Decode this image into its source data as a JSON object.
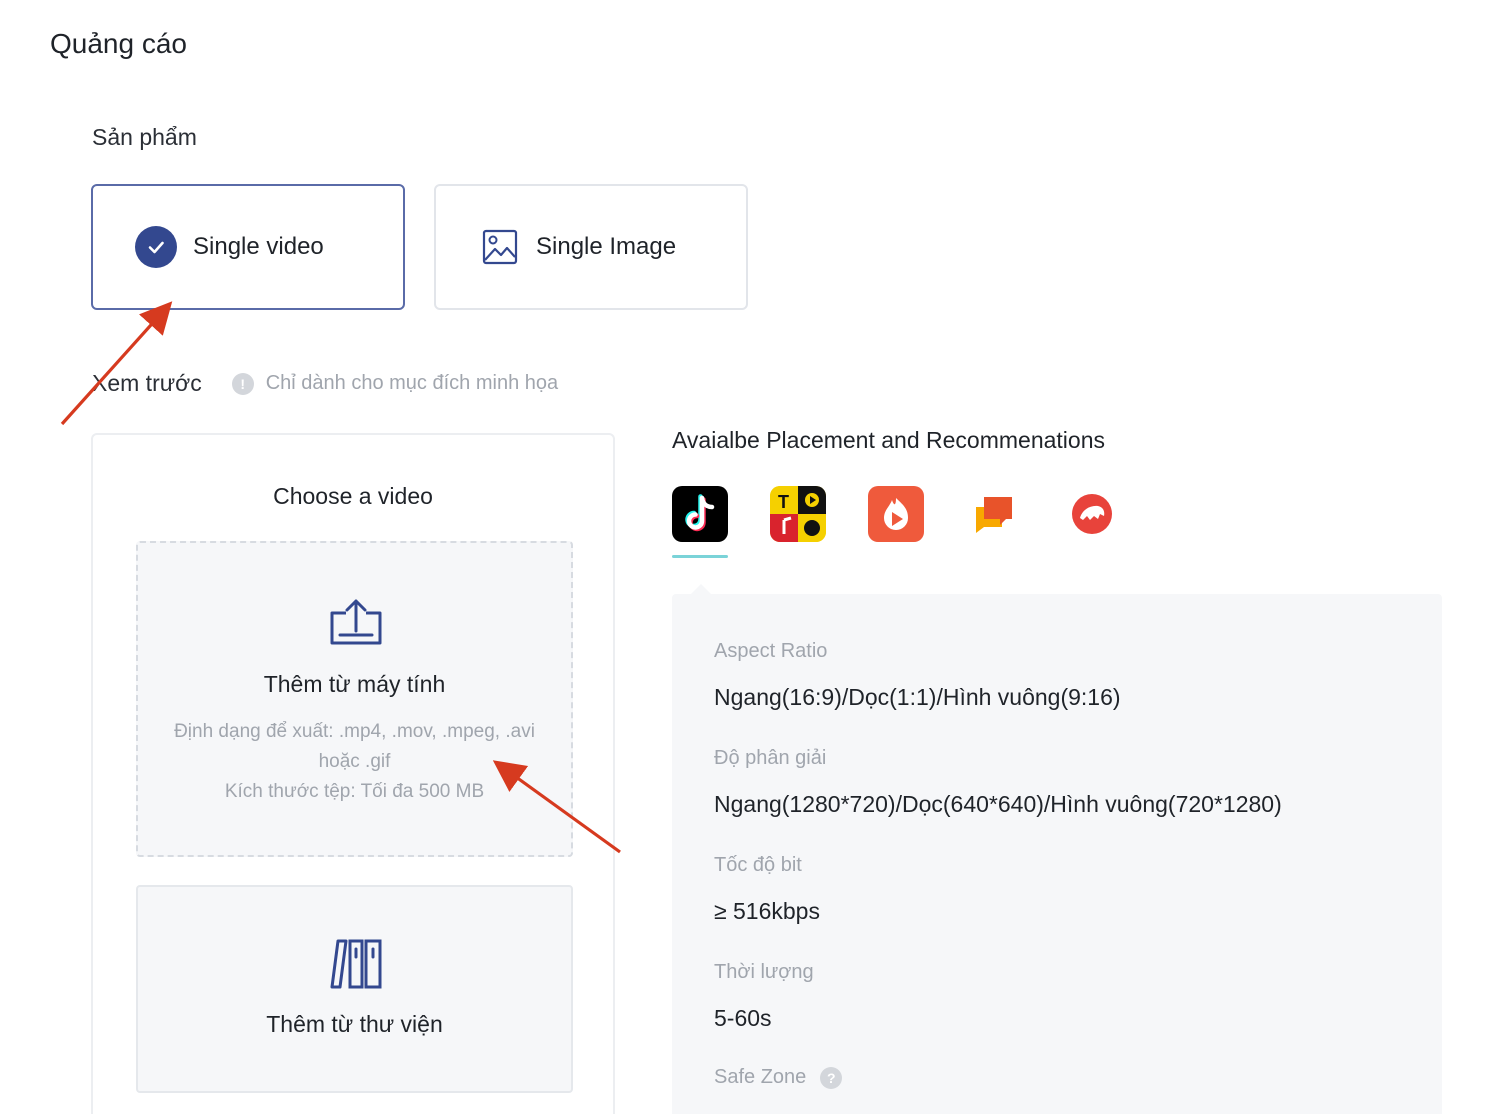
{
  "header": {
    "title": "Quảng cáo"
  },
  "products": {
    "label": "Sản phẩm",
    "options": [
      {
        "label": "Single video",
        "selected": true,
        "icon": "check-circle-icon"
      },
      {
        "label": "Single Image",
        "selected": false,
        "icon": "image-icon"
      }
    ]
  },
  "preview": {
    "label": "Xem trước",
    "note": "Chỉ dành cho mục đích minh họa"
  },
  "choose": {
    "title": "Choose a video",
    "upload": {
      "title": "Thêm từ máy tính",
      "formats": "Định dạng để xuất: .mp4, .mov, .mpeg, .avi hoặc .gif",
      "size": "Kích thước tệp: Tối đa 500 MB"
    },
    "library": {
      "title": "Thêm từ thư viện"
    }
  },
  "placement": {
    "title": "Avaialbe Placement and Recommenations",
    "apps": [
      {
        "icon": "tiktok-icon",
        "active": true,
        "color": "#000000"
      },
      {
        "icon": "topbuzz-icon",
        "active": false,
        "color": "#f5d000"
      },
      {
        "icon": "buzzvideo-icon",
        "active": false,
        "color": "#ef5a3c"
      },
      {
        "icon": "babe-icon",
        "active": false,
        "color": "#f37b1d"
      },
      {
        "icon": "pangle-icon",
        "active": false,
        "color": "#e8433b"
      }
    ]
  },
  "specs": [
    {
      "label": "Aspect Ratio",
      "value": "Ngang(16:9)/Dọc(1:1)/Hình vuông(9:16)"
    },
    {
      "label": "Độ phân giải",
      "value": "Ngang(1280*720)/Dọc(640*640)/Hình vuông(720*1280)"
    },
    {
      "label": "Tốc độ bit",
      "value": "≥ 516kbps"
    },
    {
      "label": "Thời lượng",
      "value": "5-60s"
    },
    {
      "label": "Safe Zone",
      "value": ""
    }
  ],
  "colors": {
    "primary": "#33488f",
    "annotation_arrow": "#d63a1f",
    "tab_underline": "#7ad3d8"
  }
}
